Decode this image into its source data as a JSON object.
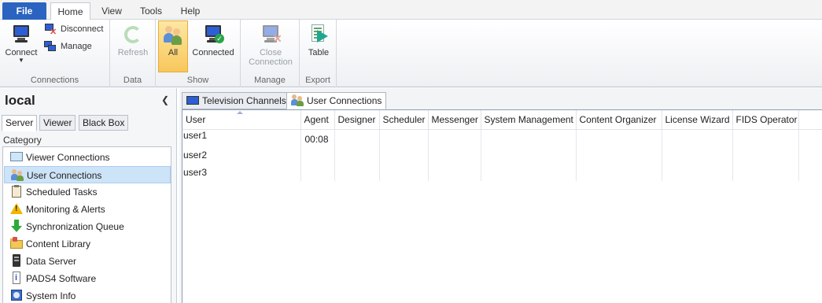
{
  "ribbon_tabs": {
    "file": "File",
    "home": "Home",
    "view": "View",
    "tools": "Tools",
    "help": "Help"
  },
  "ribbon": {
    "connections": {
      "connect": "Connect",
      "disconnect": "Disconnect",
      "manage": "Manage",
      "label": "Connections"
    },
    "data": {
      "refresh": "Refresh",
      "label": "Data"
    },
    "show": {
      "all": "All",
      "connected": "Connected",
      "label": "Show"
    },
    "manage": {
      "close_line1": "Close",
      "close_line2": "Connection",
      "label": "Manage"
    },
    "export": {
      "table": "Table",
      "label": "Export"
    }
  },
  "left": {
    "title": "local",
    "tabs": [
      "Server",
      "Viewer",
      "Black Box"
    ],
    "category_label": "Category",
    "items": [
      {
        "label": "Viewer Connections",
        "icon": "screen-icon"
      },
      {
        "label": "User Connections",
        "icon": "users-icon"
      },
      {
        "label": "Scheduled Tasks",
        "icon": "clipboard-icon"
      },
      {
        "label": "Monitoring & Alerts",
        "icon": "warning-icon"
      },
      {
        "label": "Synchronization Queue",
        "icon": "down-arrow-icon"
      },
      {
        "label": "Content Library",
        "icon": "folder-icon"
      },
      {
        "label": "Data Server",
        "icon": "server-icon"
      },
      {
        "label": "PADS4 Software",
        "icon": "info-icon"
      },
      {
        "label": "System Info",
        "icon": "system-info-icon"
      }
    ]
  },
  "doc_tabs": [
    "Television Channels",
    "User Connections"
  ],
  "grid": {
    "columns": [
      "User",
      "Agent",
      "Designer",
      "Scheduler",
      "Messenger",
      "System Management",
      "Content Organizer",
      "License Wizard",
      "FIDS Operator"
    ],
    "rows": [
      {
        "user": "user1",
        "agent": "00:08"
      },
      {
        "user": "user2",
        "agent": ""
      },
      {
        "user": "user3",
        "agent": ""
      }
    ]
  },
  "colors": {
    "file_tab": "#2a64c0",
    "selected_show": "#f8c75b",
    "selected_category": "#cde3f7"
  }
}
